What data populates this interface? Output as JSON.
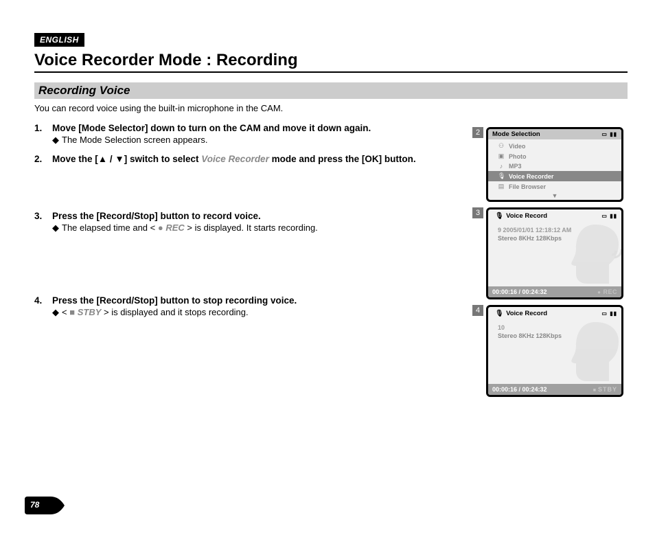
{
  "lang_tag": "ENGLISH",
  "title": "Voice Recorder Mode : Recording",
  "subheading": "Recording Voice",
  "intro": "You can record voice using the built-in microphone in the CAM.",
  "steps": {
    "s1": {
      "num": "1.",
      "main": "Move [Mode Selector] down to turn on the CAM and move it down again.",
      "sub": "The Mode Selection screen appears."
    },
    "s2": {
      "num": "2.",
      "pre": "Move the [",
      "arrows": "▲ / ▼",
      "mid": "] switch to select ",
      "mode": "Voice Recorder",
      "post": " mode and press the [OK] button."
    },
    "s3": {
      "num": "3.",
      "main": "Press the [Record/Stop] button to record voice.",
      "sub_pre": "The elapsed time and < ",
      "sub_icon": "●",
      "sub_label": "REC",
      "sub_post": " > is displayed. It starts recording."
    },
    "s4": {
      "num": "4.",
      "main": "Press the [Record/Stop] button to stop recording voice.",
      "sub_pre": "< ",
      "sub_icon": "■",
      "sub_label": "STBY",
      "sub_post": " > is displayed and it stops recording."
    }
  },
  "screen2": {
    "tag": "2",
    "header": "Mode Selection",
    "items": {
      "video": "Video",
      "photo": "Photo",
      "mp3": "MP3",
      "voice": "Voice Recorder",
      "file": "File Browser"
    }
  },
  "screen3": {
    "tag": "3",
    "header": "Voice Record",
    "line1": "9  2005/01/01 12:18:12 AM",
    "line2": "Stereo  8KHz  128Kbps",
    "time": "00:00:16 / 00:24:32",
    "state": "REC"
  },
  "screen4": {
    "tag": "4",
    "header": "Voice Record",
    "line1": "10",
    "line2": "Stereo  8KHz  128Kbps",
    "time": "00:00:16 / 00:24:32",
    "state": "STBY"
  },
  "page_number": "78"
}
